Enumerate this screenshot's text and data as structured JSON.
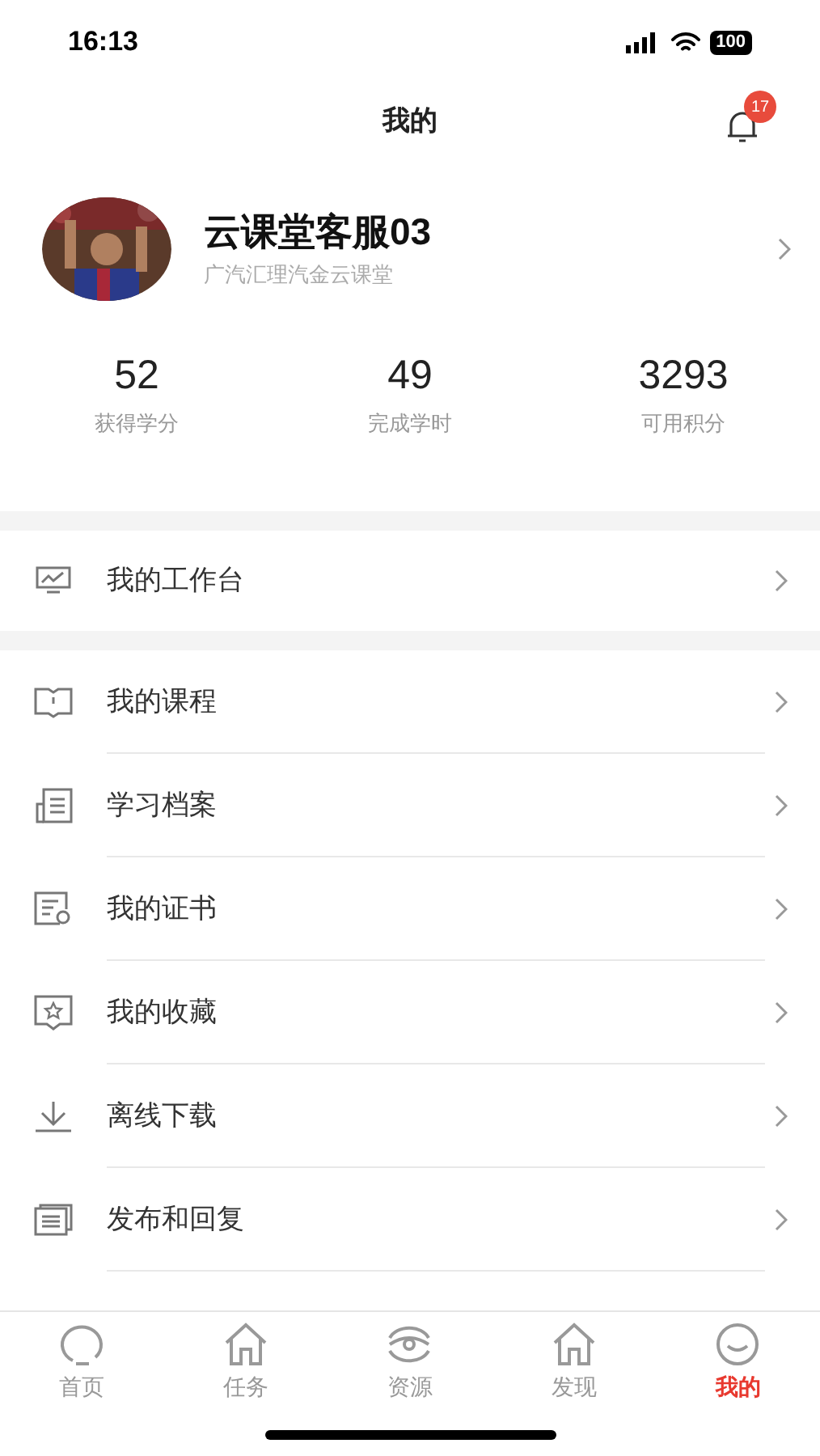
{
  "status_bar": {
    "time": "16:13",
    "battery": "100"
  },
  "header": {
    "title": "我的",
    "notification_count": "17"
  },
  "profile": {
    "name": "云课堂客服03",
    "organization": "广汽汇理汽金云课堂"
  },
  "stats": [
    {
      "value": "52",
      "label": "获得学分"
    },
    {
      "value": "49",
      "label": "完成学时"
    },
    {
      "value": "3293",
      "label": "可用积分"
    }
  ],
  "workbench": {
    "label": "我的工作台"
  },
  "menu": [
    {
      "label": "我的课程"
    },
    {
      "label": "学习档案"
    },
    {
      "label": "我的证书"
    },
    {
      "label": "我的收藏"
    },
    {
      "label": "离线下载"
    },
    {
      "label": "发布和回复"
    }
  ],
  "tab_bar": [
    {
      "label": "首页",
      "selected": false
    },
    {
      "label": "任务",
      "selected": false
    },
    {
      "label": "资源",
      "selected": false
    },
    {
      "label": "发现",
      "selected": false
    },
    {
      "label": "我的",
      "selected": true
    }
  ]
}
